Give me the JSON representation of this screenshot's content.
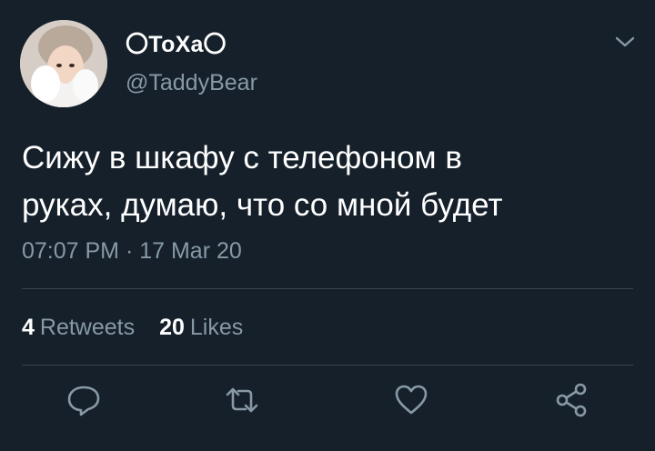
{
  "tweet": {
    "author": {
      "display_name": "〇ТоХа〇",
      "handle": "@TaddyBear",
      "avatar_icon": "avatar-photo"
    },
    "text": "Сижу в шкафу с телефоном в\nруках, думаю, что со мной будет",
    "timestamp": "07:07 PM · 17 Mar 20",
    "stats": {
      "retweets_count": "4",
      "retweets_label": "Retweets",
      "likes_count": "20",
      "likes_label": "Likes"
    },
    "menu_icon": "chevron-down-icon",
    "actions": [
      "reply-icon",
      "retweet-icon",
      "like-icon",
      "share-icon"
    ]
  },
  "theme": {
    "background": "#15202b",
    "secondary_text": "#8899a6",
    "divider": "#38444d",
    "icon_color": "#8899a6"
  }
}
